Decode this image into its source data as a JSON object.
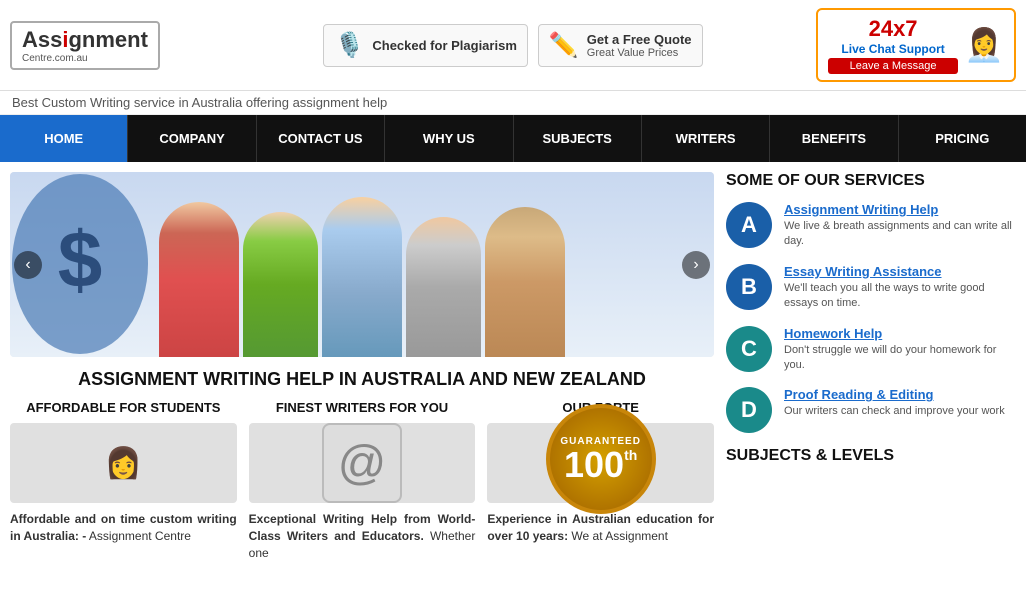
{
  "header": {
    "logo": {
      "line1": "Ass",
      "highlight": "i",
      "line2": "gnment",
      "line3": "Centre.com.au"
    },
    "tagline": "Best Custom Writing service in Australia offering assignment help",
    "badge1": {
      "icon": "🎙️",
      "text": "Checked for Plagiarism"
    },
    "badge2": {
      "icon": "✏️",
      "text": "Get a Free Quote",
      "sub": "Great Value Prices"
    },
    "chat": {
      "time": "24x7",
      "label": "Live Chat Support",
      "message": "Leave a Message"
    }
  },
  "nav": {
    "items": [
      {
        "label": "HOME",
        "active": true
      },
      {
        "label": "COMPANY",
        "active": false
      },
      {
        "label": "CONTACT US",
        "active": false
      },
      {
        "label": "WHY US",
        "active": false
      },
      {
        "label": "SUBJECTS",
        "active": false
      },
      {
        "label": "WRITERS",
        "active": false
      },
      {
        "label": "BENEFITS",
        "active": false
      },
      {
        "label": "PRICING",
        "active": false
      }
    ]
  },
  "main": {
    "heading": "ASSIGNMENT WRITING HELP IN AUSTRALIA AND NEW ZEALAND",
    "cols": [
      {
        "title": "AFFORDABLE FOR STUDENTS",
        "body_bold": "Affordable and on time custom writing in Australia: -",
        "body": " Assignment Centre"
      },
      {
        "title": "FINEST WRITERS FOR YOU",
        "body_bold": "Exceptional Writing Help from World-Class Writers and Educators.",
        "body": " Whether one"
      },
      {
        "title": "OUR FORTE",
        "body_bold": "Experience in Australian education for over 10 years:",
        "body": " We at Assignment"
      }
    ],
    "guaranteed": {
      "text": "GUARANTEED",
      "number": "100",
      "suffix": "th"
    }
  },
  "services": {
    "title": "SOME OF OUR SERVICES",
    "items": [
      {
        "letter": "A",
        "color": "blue",
        "name": "Assignment Writing Help",
        "desc": "We live & breath assignments and can write all day."
      },
      {
        "letter": "B",
        "color": "blue",
        "name": "Essay Writing Assistance",
        "desc": "We'll teach you all the ways to write good essays on time."
      },
      {
        "letter": "C",
        "color": "teal",
        "name": "Homework Help",
        "desc": "Don't struggle we will do your homework for you."
      },
      {
        "letter": "D",
        "color": "teal",
        "name": "Proof Reading & Editing",
        "desc": "Our writers can check and improve your work"
      }
    ],
    "subjects_title": "SUBJECTS & LEVELS"
  }
}
